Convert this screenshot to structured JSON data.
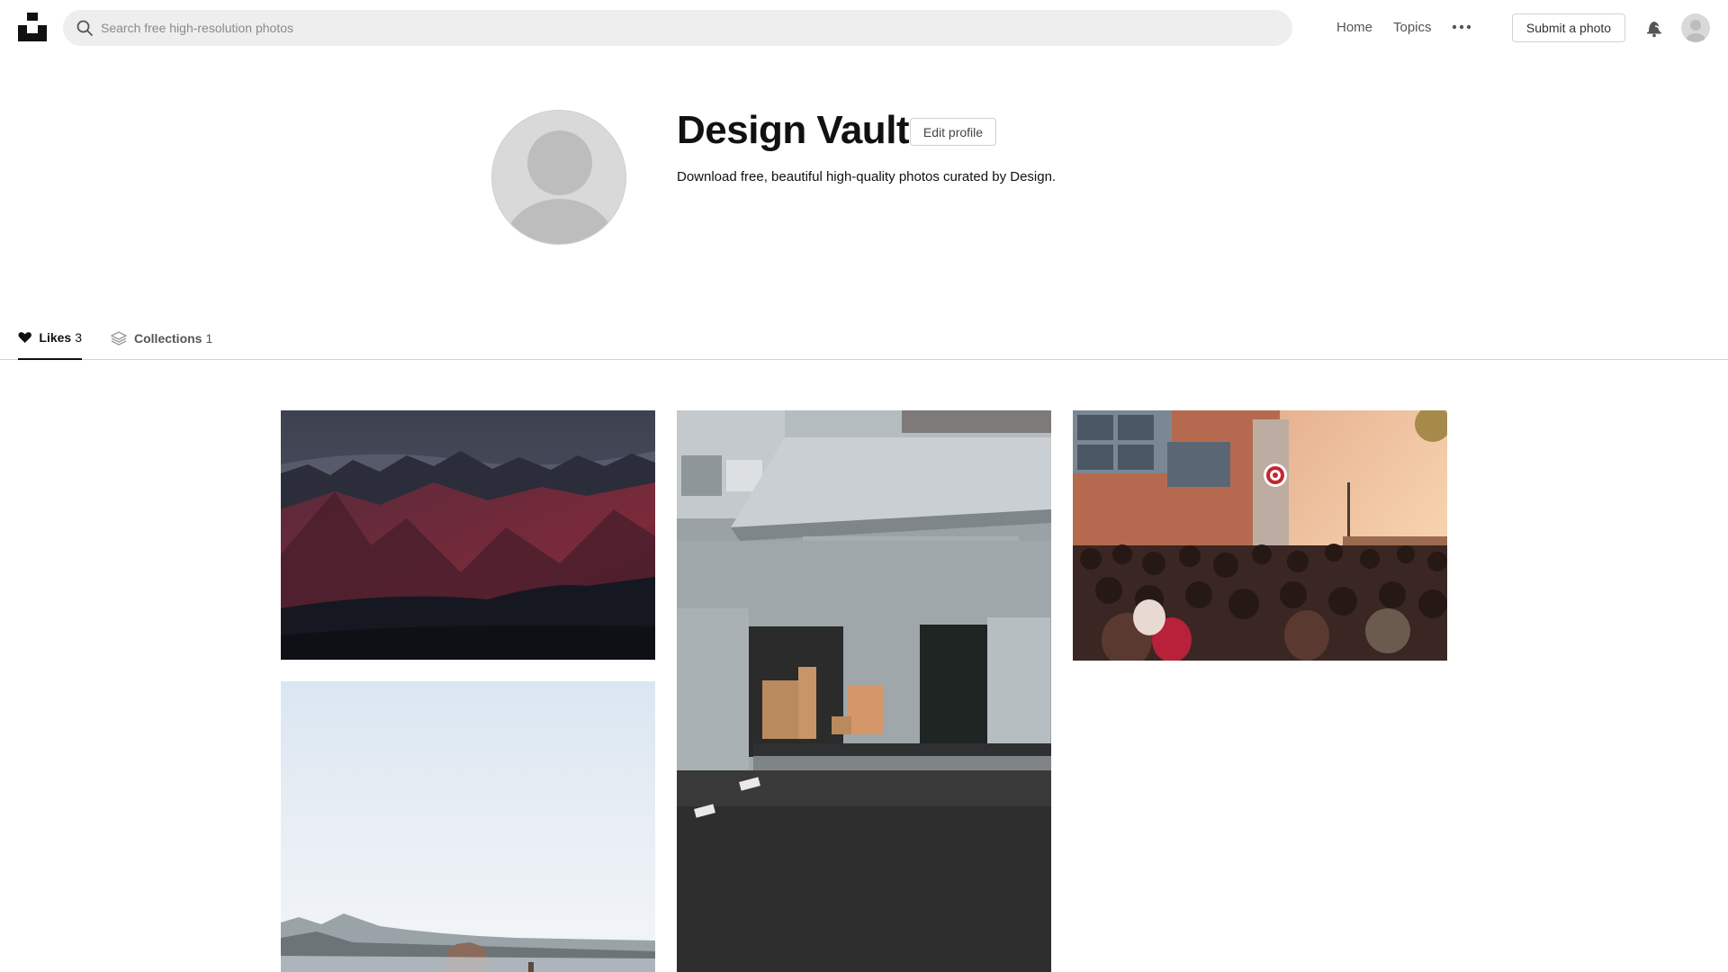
{
  "header": {
    "search_placeholder": "Search free high-resolution photos",
    "nav": {
      "home": "Home",
      "topics": "Topics"
    },
    "submit_label": "Submit a photo"
  },
  "profile": {
    "name": "Design Vault",
    "edit_label": "Edit profile",
    "bio": "Download free, beautiful high-quality photos curated by Design."
  },
  "tabs": [
    {
      "label": "Likes",
      "count": "3",
      "icon": "heart-icon",
      "active": true
    },
    {
      "label": "Collections",
      "count": "1",
      "icon": "collections-icon",
      "active": false
    }
  ],
  "photos": [
    {
      "subject": "mountains-dusk"
    },
    {
      "subject": "warehouse-loading-dock"
    },
    {
      "subject": "crowd-storefront"
    },
    {
      "subject": "coastal-rock"
    }
  ],
  "colors": {
    "accent": "#111111",
    "search_bg": "#eeeeee",
    "border": "#d1d1d1"
  }
}
